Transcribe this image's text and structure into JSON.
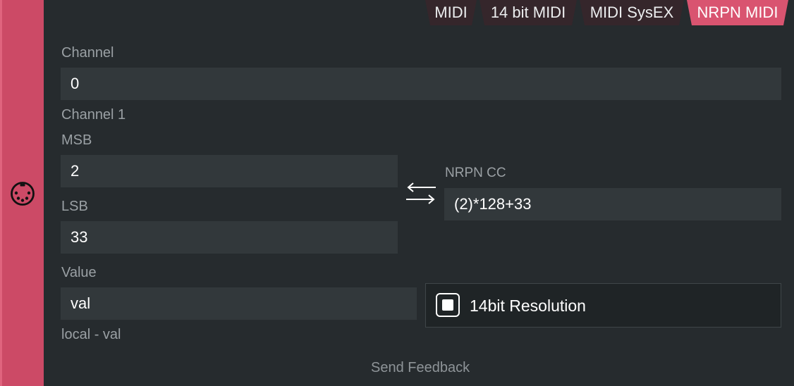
{
  "tabs": [
    {
      "label": "MIDI",
      "active": false
    },
    {
      "label": "14 bit MIDI",
      "active": false
    },
    {
      "label": "MIDI SysEX",
      "active": false
    },
    {
      "label": "NRPN MIDI",
      "active": true
    }
  ],
  "sidebar": {
    "icon": "midi-connector-icon"
  },
  "channel": {
    "label": "Channel",
    "value": "0",
    "hint": "Channel 1"
  },
  "msb": {
    "label": "MSB",
    "value": "2"
  },
  "lsb": {
    "label": "LSB",
    "value": "33"
  },
  "nrpn": {
    "label": "NRPN CC",
    "value": "(2)*128+33",
    "swap_icon": "swap-arrows-icon"
  },
  "value": {
    "label": "Value",
    "value": "val",
    "hint": "local - val"
  },
  "resolution": {
    "label": "14bit Resolution",
    "checked": true
  },
  "feedback": {
    "label": "Send Feedback"
  },
  "colors": {
    "accent": "#cc4a66",
    "active_tab": "#d95470",
    "background": "#262b2e",
    "field": "#32383b"
  }
}
